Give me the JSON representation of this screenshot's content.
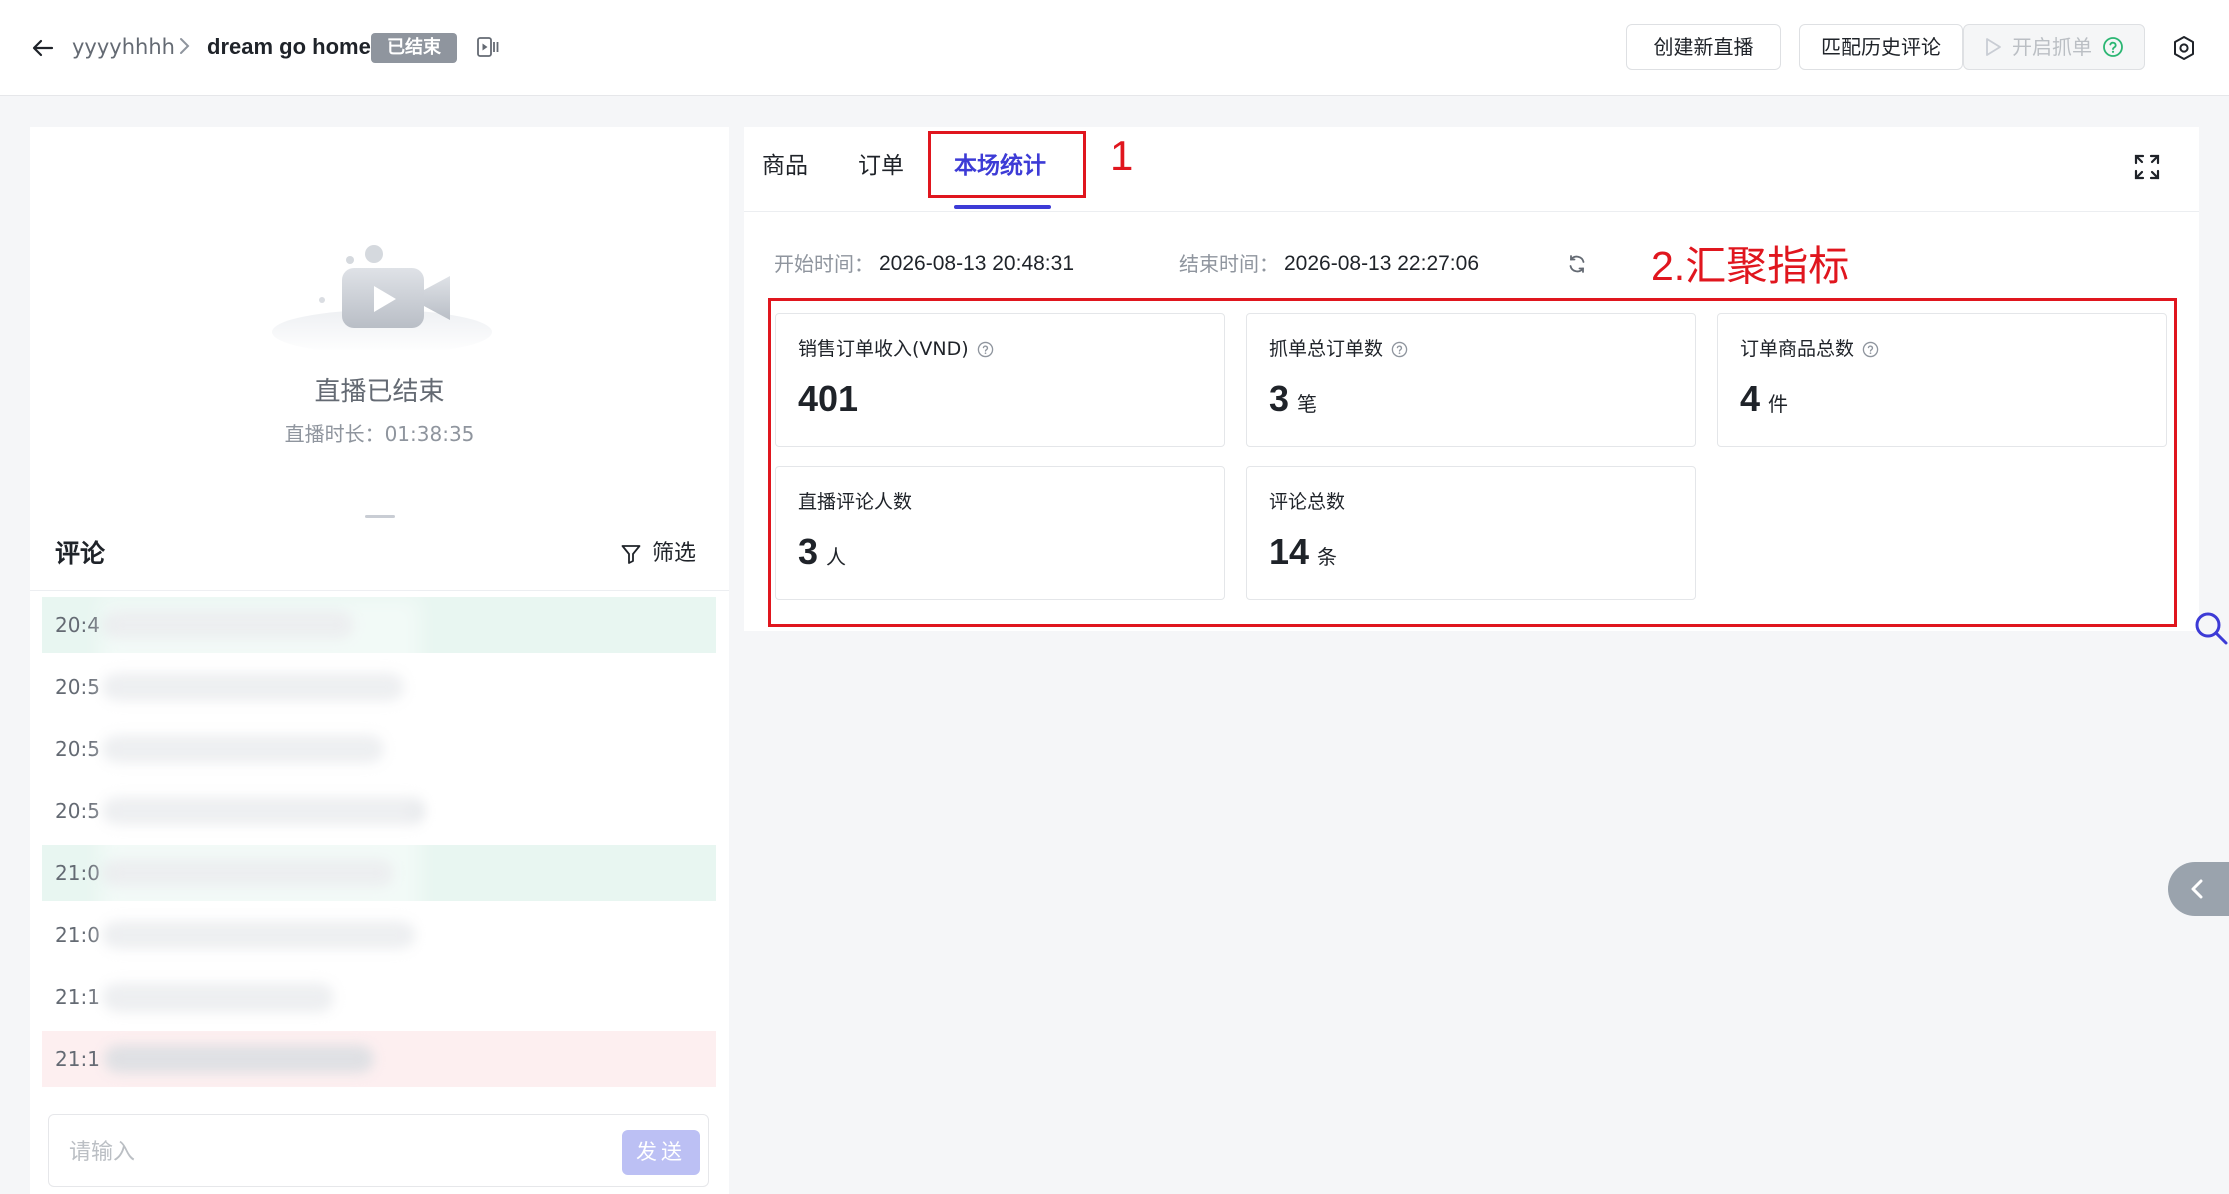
{
  "header": {
    "parent_name": "yyyyhhhh",
    "live_title": "dream go home",
    "status_badge": "已结束",
    "actions": {
      "create_live": "创建新直播",
      "match_history": "匹配历史评论",
      "start_grab": "开启抓单"
    }
  },
  "left": {
    "ended_title": "直播已结束",
    "duration_label": "直播时长：",
    "duration_value": "01:38:35",
    "comments_title": "评论",
    "filter_label": "筛选",
    "comments": [
      {
        "time": "20:4",
        "highlight": "green"
      },
      {
        "time": "20:5",
        "highlight": "none"
      },
      {
        "time": "20:5",
        "highlight": "none"
      },
      {
        "time": "20:5",
        "highlight": "none"
      },
      {
        "time": "21:0",
        "highlight": "green"
      },
      {
        "time": "21:0",
        "highlight": "none"
      },
      {
        "time": "21:1",
        "highlight": "none"
      },
      {
        "time": "21:1",
        "highlight": "red"
      }
    ],
    "input_placeholder": "请输入",
    "send_label": "发送"
  },
  "right": {
    "tabs": [
      {
        "label": "商品",
        "active": false
      },
      {
        "label": "订单",
        "active": false
      },
      {
        "label": "本场统计",
        "active": true
      }
    ],
    "start_time_label": "开始时间：",
    "start_time": "2026-08-13 20:48:31",
    "end_time_label": "结束时间：",
    "end_time": "2026-08-13 22:27:06",
    "metrics": [
      {
        "label": "销售订单收入(VND)",
        "value": "401",
        "unit": "",
        "help": true
      },
      {
        "label": "抓单总订单数",
        "value": "3",
        "unit": "笔",
        "help": true
      },
      {
        "label": "订单商品总数",
        "value": "4",
        "unit": "件",
        "help": true
      },
      {
        "label": "直播评论人数",
        "value": "3",
        "unit": "人",
        "help": false
      },
      {
        "label": "评论总数",
        "value": "14",
        "unit": "条",
        "help": false
      }
    ]
  },
  "annotations": {
    "tab_marker": "1",
    "metrics_marker": "2.汇聚指标"
  },
  "colors": {
    "accent": "#3d3bd6",
    "annotation_red": "#e0161e",
    "badge_gray": "#8f959e",
    "green_highlight": "#e8f6f1",
    "red_highlight": "#fdeff0"
  }
}
